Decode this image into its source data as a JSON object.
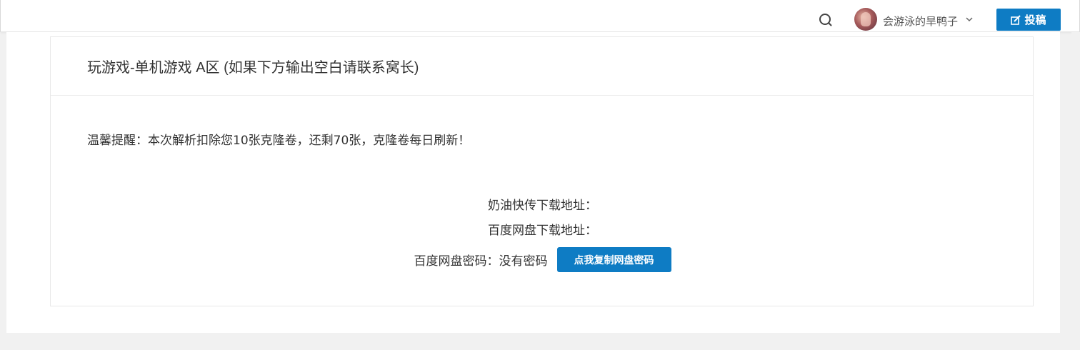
{
  "header": {
    "username": "会游泳的旱鸭子",
    "post_label": "投稿"
  },
  "card": {
    "title": "玩游戏-单机游戏 A区 (如果下方输出空白请联系窝长)",
    "notice": "温馨提醒：本次解析扣除您10张克隆卷，还剩70张，克隆卷每日刷新！",
    "naiyou_label": "奶油快传下载地址：",
    "baidu_label": "百度网盘下载地址：",
    "baidu_pwd_label": "百度网盘密码：没有密码",
    "copy_button_label": "点我复制网盘密码"
  },
  "colors": {
    "accent": "#0e7cc4",
    "background": "#f1f1f1"
  },
  "icons": [
    "search-icon",
    "avatar",
    "chevron-down-icon",
    "edit-icon"
  ]
}
